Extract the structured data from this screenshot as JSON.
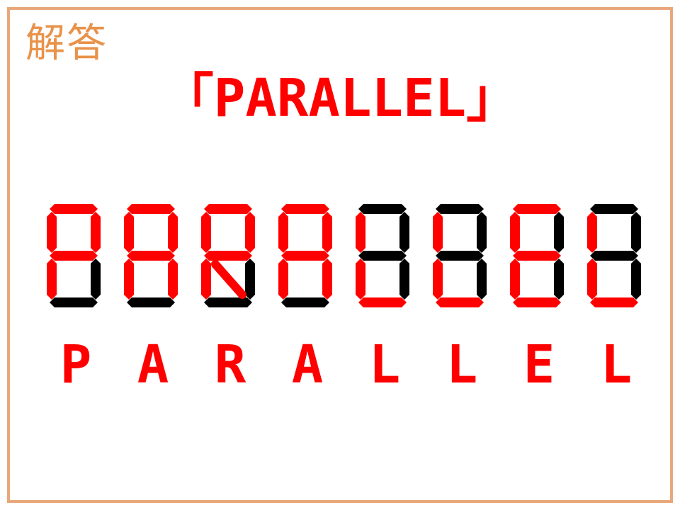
{
  "heading": {
    "label": "解答"
  },
  "answer": {
    "title": "「PARALLEL」",
    "letters": [
      "P",
      "A",
      "R",
      "A",
      "L",
      "L",
      "E",
      "L"
    ]
  },
  "colors": {
    "frame": "#e8a87c",
    "heading": "#e8924a",
    "accent": "#ff0000",
    "segment_off": "#000000"
  },
  "digits": [
    {
      "letter": "P",
      "lit": [
        "a",
        "b",
        "e",
        "f",
        "g"
      ]
    },
    {
      "letter": "A",
      "lit": [
        "a",
        "b",
        "c",
        "e",
        "f",
        "g"
      ]
    },
    {
      "letter": "R",
      "lit": [
        "a",
        "b",
        "e",
        "f",
        "g",
        "r"
      ]
    },
    {
      "letter": "A",
      "lit": [
        "a",
        "b",
        "c",
        "e",
        "f",
        "g"
      ]
    },
    {
      "letter": "L",
      "lit": [
        "d",
        "e",
        "f"
      ]
    },
    {
      "letter": "L",
      "lit": [
        "d",
        "e",
        "f"
      ]
    },
    {
      "letter": "E",
      "lit": [
        "a",
        "d",
        "e",
        "f",
        "g"
      ]
    },
    {
      "letter": "L",
      "lit": [
        "d",
        "e",
        "f"
      ]
    }
  ]
}
